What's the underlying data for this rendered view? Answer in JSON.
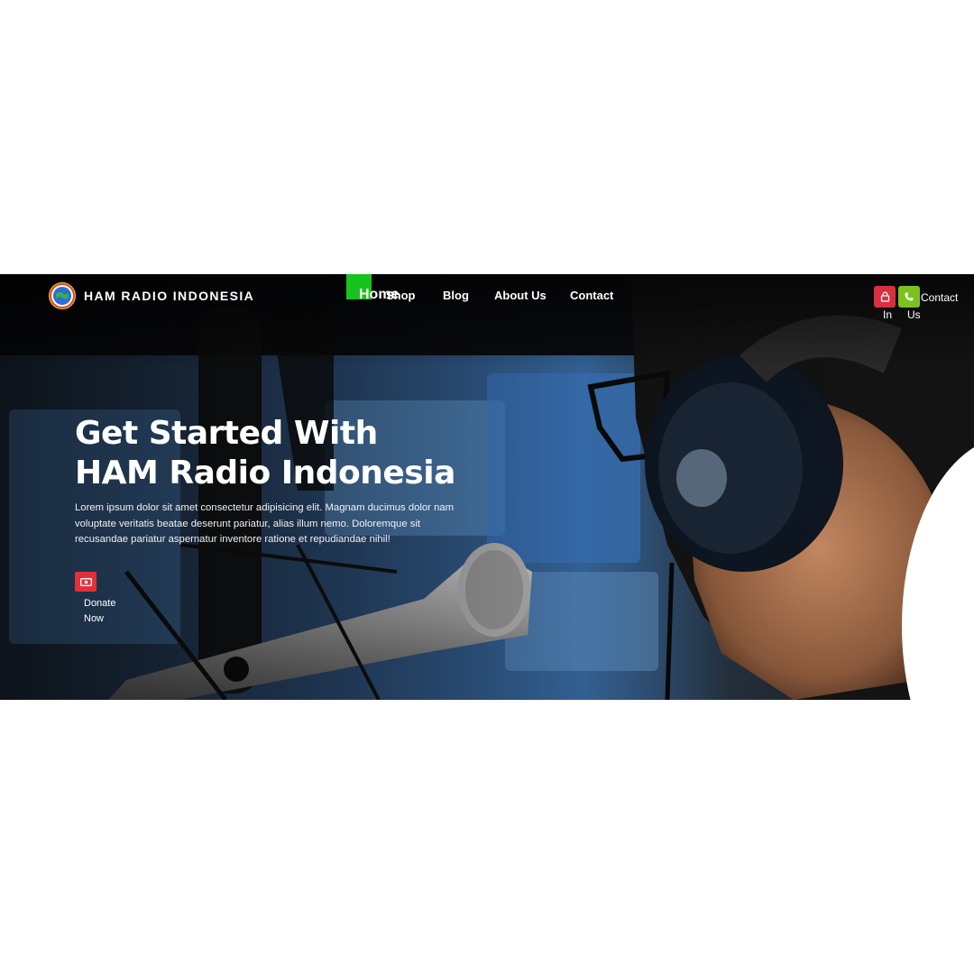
{
  "brand": {
    "name": "HAM RADIO INDONESIA",
    "logo_icon": "globe-emblem-icon"
  },
  "nav": {
    "items": [
      {
        "label": "Home",
        "active": true
      },
      {
        "label": "Shop",
        "active": false
      },
      {
        "label": "Blog",
        "active": false
      },
      {
        "label": "About Us",
        "active": false
      },
      {
        "label": "Contact",
        "active": false
      }
    ]
  },
  "actions": {
    "login": {
      "label": "In",
      "icon": "lock-icon",
      "color": "#d9303f"
    },
    "contact_us": {
      "label_line1": "Contact",
      "label_line2": "Us",
      "icon": "phone-icon",
      "color": "#7cc21e"
    }
  },
  "hero": {
    "title_line1": "Get Started With",
    "title_line2": "HAM Radio Indonesia",
    "description": "Lorem ipsum dolor sit amet consectetur adipisicing elit. Magnam ducimus dolor nam voluptate veritatis beatae deserunt pariatur, alias illum nemo. Doloremque sit recusandae pariatur aspernatur inventore ratione et repudiandae nihil!",
    "donate": {
      "label": "Donate Now",
      "icon": "money-icon",
      "color": "#e0303a"
    }
  },
  "colors": {
    "nav_active_indicator": "#18c21c",
    "text": "#ffffff"
  }
}
